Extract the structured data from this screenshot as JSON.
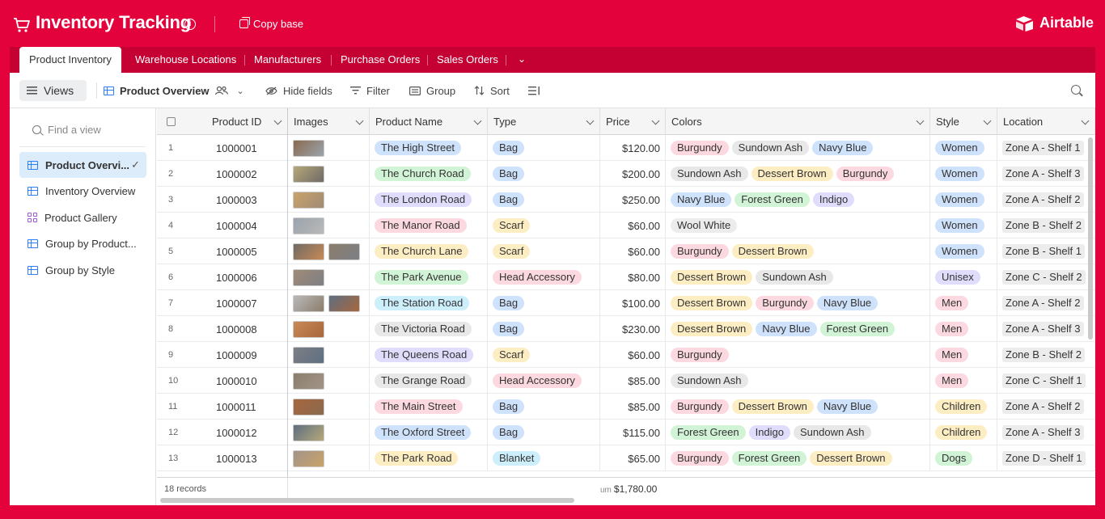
{
  "header": {
    "base_title": "Inventory Tracking",
    "copy_base": "Copy base",
    "logo_text": "Airtable"
  },
  "tabs": [
    "Product Inventory",
    "Warehouse Locations",
    "Manufacturers",
    "Purchase Orders",
    "Sales Orders"
  ],
  "toolbar": {
    "views": "Views",
    "view_name": "Product Overview",
    "hide_fields": "Hide fields",
    "filter": "Filter",
    "group": "Group",
    "sort": "Sort"
  },
  "sidebar": {
    "find_placeholder": "Find a view",
    "views": [
      {
        "label": "Product Overvi...",
        "kind": "grid",
        "active": true
      },
      {
        "label": "Inventory Overview",
        "kind": "grid"
      },
      {
        "label": "Product Gallery",
        "kind": "gallery"
      },
      {
        "label": "Group by Product...",
        "kind": "grid"
      },
      {
        "label": "Group by Style",
        "kind": "grid"
      }
    ]
  },
  "columns": [
    "Product ID",
    "Images",
    "Product Name",
    "Type",
    "Price",
    "Colors",
    "Style",
    "Location"
  ],
  "rows": [
    {
      "n": "1",
      "id": "1000001",
      "images": 1,
      "name": "The High Street",
      "type": "Bag",
      "price": "$120.00",
      "colors": [
        "Burgundy",
        "Sundown Ash",
        "Navy Blue"
      ],
      "style": "Women",
      "loc": "Zone A - Shelf 1"
    },
    {
      "n": "2",
      "id": "1000002",
      "images": 1,
      "name": "The Church Road",
      "type": "Bag",
      "price": "$200.00",
      "colors": [
        "Sundown Ash",
        "Dessert Brown",
        "Burgundy"
      ],
      "style": "Women",
      "loc": "Zone A - Shelf 3"
    },
    {
      "n": "3",
      "id": "1000003",
      "images": 1,
      "name": "The London Road",
      "type": "Bag",
      "price": "$250.00",
      "colors": [
        "Navy Blue",
        "Forest Green",
        "Indigo"
      ],
      "style": "Women",
      "loc": "Zone A - Shelf 2"
    },
    {
      "n": "4",
      "id": "1000004",
      "images": 1,
      "name": "The Manor Road",
      "type": "Scarf",
      "price": "$60.00",
      "colors": [
        "Wool White"
      ],
      "style": "Women",
      "loc": "Zone B - Shelf 2"
    },
    {
      "n": "5",
      "id": "1000005",
      "images": 2,
      "name": "The Church Lane",
      "type": "Scarf",
      "price": "$60.00",
      "colors": [
        "Burgundy",
        "Dessert Brown"
      ],
      "style": "Women",
      "loc": "Zone B - Shelf 1"
    },
    {
      "n": "6",
      "id": "1000006",
      "images": 1,
      "name": "The Park Avenue",
      "type": "Head Accessory",
      "price": "$80.00",
      "colors": [
        "Dessert Brown",
        "Sundown Ash"
      ],
      "style": "Unisex",
      "loc": "Zone C - Shelf 2"
    },
    {
      "n": "7",
      "id": "1000007",
      "images": 2,
      "name": "The Station Road",
      "type": "Bag",
      "price": "$100.00",
      "colors": [
        "Dessert Brown",
        "Burgundy",
        "Navy Blue"
      ],
      "style": "Men",
      "loc": "Zone A - Shelf 2"
    },
    {
      "n": "8",
      "id": "1000008",
      "images": 1,
      "name": "The Victoria Road",
      "type": "Bag",
      "price": "$230.00",
      "colors": [
        "Dessert Brown",
        "Navy Blue",
        "Forest Green"
      ],
      "style": "Men",
      "loc": "Zone A - Shelf 3"
    },
    {
      "n": "9",
      "id": "1000009",
      "images": 1,
      "name": "The Queens Road",
      "type": "Scarf",
      "price": "$60.00",
      "colors": [
        "Burgundy"
      ],
      "style": "Men",
      "loc": "Zone B - Shelf 2"
    },
    {
      "n": "10",
      "id": "1000010",
      "images": 1,
      "name": "The Grange Road",
      "type": "Head Accessory",
      "price": "$85.00",
      "colors": [
        "Sundown Ash"
      ],
      "style": "Men",
      "loc": "Zone C - Shelf 1"
    },
    {
      "n": "11",
      "id": "1000011",
      "images": 1,
      "name": "The Main Street",
      "type": "Bag",
      "price": "$85.00",
      "colors": [
        "Burgundy",
        "Dessert Brown",
        "Navy Blue"
      ],
      "style": "Children",
      "loc": "Zone A - Shelf 2"
    },
    {
      "n": "12",
      "id": "1000012",
      "images": 1,
      "name": "The Oxford Street",
      "type": "Bag",
      "price": "$115.00",
      "colors": [
        "Forest Green",
        "Indigo",
        "Sundown Ash"
      ],
      "style": "Children",
      "loc": "Zone A - Shelf 3"
    },
    {
      "n": "13",
      "id": "1000013",
      "images": 1,
      "name": "The Park Road",
      "type": "Blanket",
      "price": "$65.00",
      "colors": [
        "Burgundy",
        "Forest Green",
        "Dessert Brown"
      ],
      "style": "Dogs",
      "loc": "Zone D - Shelf 1"
    }
  ],
  "footer": {
    "records": "18 records",
    "sum_label": "um",
    "sum_value": "$1,780.00"
  },
  "colors": {
    "brand": "#e3023b",
    "tab_bar": "#c50033",
    "name_pills": {
      "The High Street": "#cfe2fb",
      "The Church Road": "#d1f3d6",
      "The London Road": "#e0dcfb",
      "The Manor Road": "#fcd9e1",
      "The Church Lane": "#fdedc3",
      "The Park Avenue": "#d1f3d6",
      "The Station Road": "#cdeefb",
      "The Victoria Road": "#e8e8e8",
      "The Queens Road": "#e0dcfb",
      "The Grange Road": "#e8e8e8",
      "The Main Street": "#fcd9e1",
      "The Oxford Street": "#cfe2fb",
      "The Park Road": "#fdedc3"
    },
    "type_pills": {
      "Bag": "#cfe2fb",
      "Scarf": "#fdedc3",
      "Head Accessory": "#fcd9e1",
      "Blanket": "#cdeefb"
    },
    "color_pills": {
      "Burgundy": "#fcd9e1",
      "Sundown Ash": "#e8e8e8",
      "Navy Blue": "#cfe2fb",
      "Dessert Brown": "#fdedc3",
      "Forest Green": "#d1f3d6",
      "Indigo": "#e0dcfb",
      "Wool White": "#ececec"
    },
    "style_pills": {
      "Women": "#cfe2fb",
      "Unisex": "#e0dcfb",
      "Men": "#fcd9e1",
      "Children": "#fdedc3",
      "Dogs": "#d1f3d6"
    },
    "location_pill": "#ececec"
  }
}
